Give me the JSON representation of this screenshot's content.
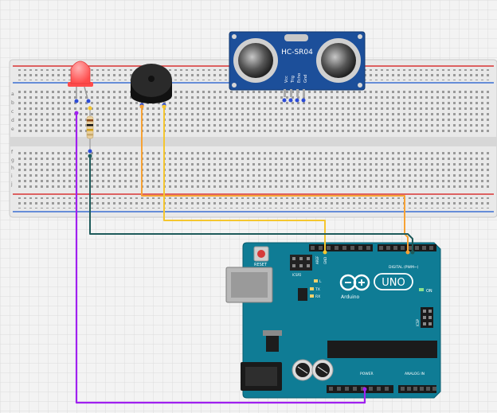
{
  "sensor": {
    "model_label": "HC-SR04",
    "pins": [
      "Vcc",
      "Trig",
      "Echo",
      "Gnd"
    ]
  },
  "arduino": {
    "brand_label": "Arduino",
    "model_label": "UNO",
    "reset_label": "RESET",
    "icsp_label": "ICSP",
    "icsp2_label": "ICSP2",
    "digital_label": "DIGITAL (PWM~)",
    "analog_label": "ANALOG IN",
    "power_label": "POWER",
    "on_label": "ON",
    "tx_label": "TX",
    "rx_label": "RX",
    "l_label": "L",
    "aref_label": "AREF",
    "gnd_label": "GND"
  },
  "breadboard": {
    "row_letters_top": [
      "a",
      "b",
      "c",
      "d",
      "e"
    ],
    "row_letters_bottom": [
      "f",
      "g",
      "h",
      "i",
      "j"
    ]
  },
  "colors": {
    "wire_orange": "#f7a234",
    "wire_yellow": "#f5c62f",
    "wire_teal": "#1e5b5b",
    "wire_purple": "#a020f0",
    "board_blue": "#0f7c95",
    "sensor_blue": "#1c4f9a",
    "led_red": "#ff6464",
    "rail_red": "#d93434",
    "rail_blue": "#3a6fd2"
  }
}
